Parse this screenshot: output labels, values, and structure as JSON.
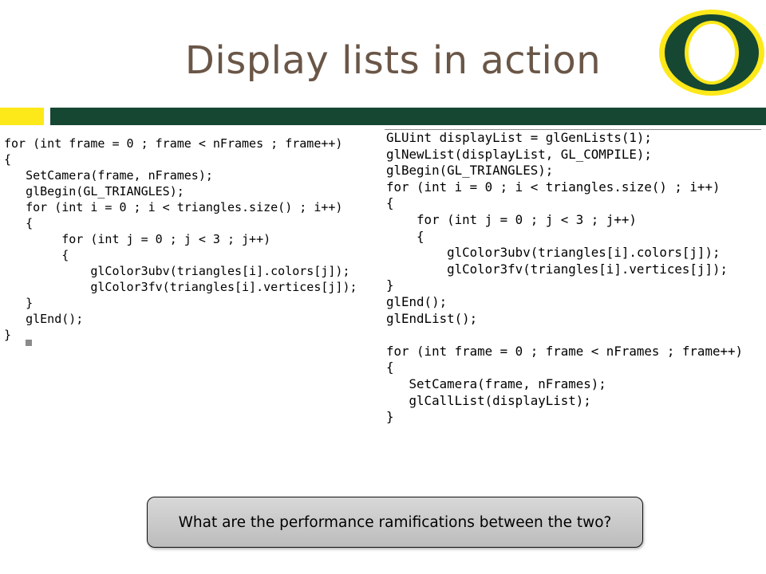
{
  "slide": {
    "title": "Display lists in action",
    "question": "What are the performance ramifications between the two?"
  },
  "logo": {
    "letter": "O",
    "name": "university-of-oregon-logo"
  },
  "colors": {
    "title": "#6a5647",
    "accent_yellow": "#fde81a",
    "accent_green": "#154733"
  },
  "code_left": {
    "lines": [
      "for (int frame = 0 ; frame < nFrames ; frame++)",
      "{",
      "   SetCamera(frame, nFrames);",
      "   glBegin(GL_TRIANGLES);",
      "   for (int i = 0 ; i < triangles.size() ; i++)",
      "   {",
      "        for (int j = 0 ; j < 3 ; j++)",
      "        {",
      "            glColor3ubv(triangles[i].colors[j]);",
      "            glColor3fv(triangles[i].vertices[j]);",
      "   }",
      "   glEnd();",
      "}"
    ]
  },
  "code_right": {
    "lines": [
      "GLUint displayList = glGenLists(1);",
      "glNewList(displayList, GL_COMPILE);",
      "glBegin(GL_TRIANGLES);",
      "for (int i = 0 ; i < triangles.size() ; i++)",
      "{",
      "    for (int j = 0 ; j < 3 ; j++)",
      "    {",
      "        glColor3ubv(triangles[i].colors[j]);",
      "        glColor3fv(triangles[i].vertices[j]);",
      "}",
      "glEnd();",
      "glEndList();",
      "",
      "for (int frame = 0 ; frame < nFrames ; frame++)",
      "{",
      "   SetCamera(frame, nFrames);",
      "   glCallList(displayList);",
      "}"
    ]
  }
}
